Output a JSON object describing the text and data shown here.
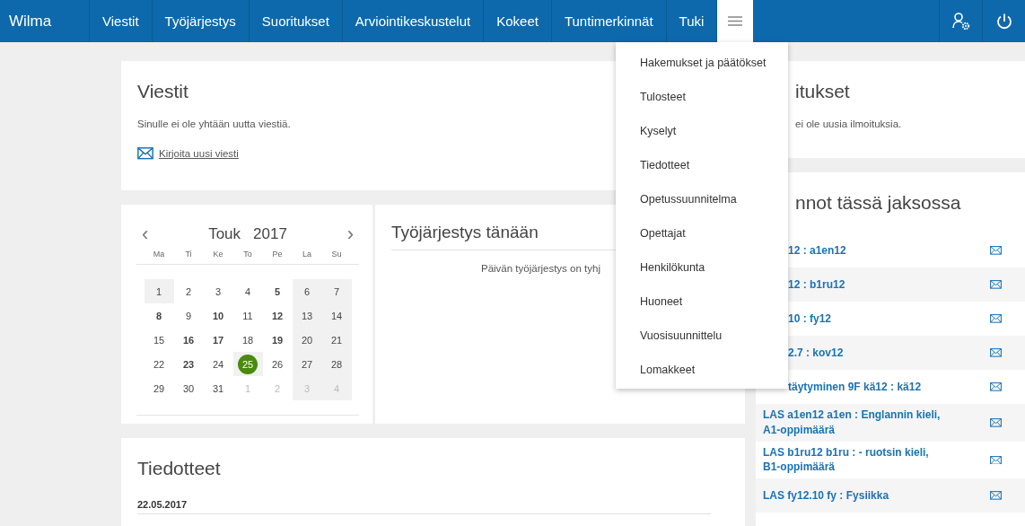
{
  "nav": {
    "brand": "Wilma",
    "items": [
      {
        "label": "Viestit",
        "selected": false
      },
      {
        "label": "Työjärjestys",
        "selected": false
      },
      {
        "label": "Suoritukset",
        "selected": false
      },
      {
        "label": "Arviointikeskustelut",
        "selected": false
      },
      {
        "label": "Kokeet",
        "selected": false
      },
      {
        "label": "Tuntimerkinnät",
        "selected": false
      },
      {
        "label": "Tuki",
        "selected": false
      }
    ],
    "menu_button": {
      "expanded": true
    }
  },
  "menu": {
    "items": [
      "Hakemukset ja päätökset",
      "Tulosteet",
      "Kyselyt",
      "Tiedotteet",
      "Opetussuunnitelma",
      "Opettajat",
      "Henkilökunta",
      "Huoneet",
      "Vuosisuunnittelu",
      "Lomakkeet"
    ]
  },
  "messages": {
    "title": "Viestit",
    "text": "Sinulle ei ole yhtään uutta viestiä.",
    "link": "Kirjoita uusi viesti"
  },
  "calendar": {
    "prev": "‹",
    "month": "Touk",
    "year": "2017",
    "next": "›",
    "weekdays": [
      "Ma",
      "Ti",
      "Ke",
      "To",
      "Pe",
      "La",
      "Su"
    ],
    "days": [
      {
        "d": "1",
        "bold": false,
        "muted": false,
        "shaded": true,
        "today": false
      },
      {
        "d": "2",
        "bold": false,
        "muted": false,
        "shaded": false,
        "today": false
      },
      {
        "d": "3",
        "bold": false,
        "muted": false,
        "shaded": false,
        "today": false
      },
      {
        "d": "4",
        "bold": false,
        "muted": false,
        "shaded": false,
        "today": false
      },
      {
        "d": "5",
        "bold": true,
        "muted": false,
        "shaded": false,
        "today": false
      },
      {
        "d": "6",
        "bold": false,
        "muted": false,
        "shaded": true,
        "today": false
      },
      {
        "d": "7",
        "bold": false,
        "muted": false,
        "shaded": true,
        "today": false
      },
      {
        "d": "8",
        "bold": true,
        "muted": false,
        "shaded": false,
        "today": false
      },
      {
        "d": "9",
        "bold": false,
        "muted": false,
        "shaded": false,
        "today": false
      },
      {
        "d": "10",
        "bold": true,
        "muted": false,
        "shaded": false,
        "today": false
      },
      {
        "d": "11",
        "bold": false,
        "muted": false,
        "shaded": false,
        "today": false
      },
      {
        "d": "12",
        "bold": true,
        "muted": false,
        "shaded": false,
        "today": false
      },
      {
        "d": "13",
        "bold": false,
        "muted": false,
        "shaded": true,
        "today": false
      },
      {
        "d": "14",
        "bold": false,
        "muted": false,
        "shaded": true,
        "today": false
      },
      {
        "d": "15",
        "bold": false,
        "muted": false,
        "shaded": false,
        "today": false
      },
      {
        "d": "16",
        "bold": true,
        "muted": false,
        "shaded": false,
        "today": false
      },
      {
        "d": "17",
        "bold": true,
        "muted": false,
        "shaded": false,
        "today": false
      },
      {
        "d": "18",
        "bold": false,
        "muted": false,
        "shaded": false,
        "today": false
      },
      {
        "d": "19",
        "bold": true,
        "muted": false,
        "shaded": false,
        "today": false
      },
      {
        "d": "20",
        "bold": false,
        "muted": false,
        "shaded": true,
        "today": false
      },
      {
        "d": "21",
        "bold": false,
        "muted": false,
        "shaded": true,
        "today": false
      },
      {
        "d": "22",
        "bold": false,
        "muted": false,
        "shaded": false,
        "today": false
      },
      {
        "d": "23",
        "bold": true,
        "muted": false,
        "shaded": false,
        "today": false
      },
      {
        "d": "24",
        "bold": false,
        "muted": false,
        "shaded": false,
        "today": false
      },
      {
        "d": "25",
        "bold": false,
        "muted": false,
        "shaded": true,
        "today": true
      },
      {
        "d": "26",
        "bold": false,
        "muted": false,
        "shaded": false,
        "today": false
      },
      {
        "d": "27",
        "bold": false,
        "muted": false,
        "shaded": true,
        "today": false
      },
      {
        "d": "28",
        "bold": false,
        "muted": false,
        "shaded": true,
        "today": false
      },
      {
        "d": "29",
        "bold": false,
        "muted": false,
        "shaded": false,
        "today": false
      },
      {
        "d": "30",
        "bold": false,
        "muted": false,
        "shaded": false,
        "today": false
      },
      {
        "d": "31",
        "bold": false,
        "muted": false,
        "shaded": false,
        "today": false
      },
      {
        "d": "1",
        "bold": false,
        "muted": true,
        "shaded": false,
        "today": false
      },
      {
        "d": "2",
        "bold": false,
        "muted": true,
        "shaded": false,
        "today": false
      },
      {
        "d": "3",
        "bold": false,
        "muted": true,
        "shaded": true,
        "today": false
      },
      {
        "d": "4",
        "bold": false,
        "muted": true,
        "shaded": true,
        "today": false
      }
    ]
  },
  "schedule": {
    "title": "Työjärjestys tänään",
    "text": "Päivän työjärjestys on tyhj"
  },
  "notices": {
    "title": "Tiedotteet",
    "date": "22.05.2017"
  },
  "announcements": {
    "title": "itukset",
    "text": "ei ole uusia ilmoituksia."
  },
  "courses": {
    "title": "nnot tässä jaksossa",
    "rows": [
      {
        "label": "12 : a1en12",
        "hidden_start": true
      },
      {
        "label": "12 : b1ru12",
        "hidden_start": true
      },
      {
        "label": "10 : fy12",
        "hidden_start": true
      },
      {
        "label": "2.7 : kov12",
        "hidden_start": true
      },
      {
        "label": "täytyminen 9F kä12 : kä12",
        "hidden_start": true
      },
      {
        "label": "LAS a1en12 a1en : Englannin kieli, A1-oppimäärä",
        "hidden_start": false
      },
      {
        "label": "LAS b1ru12 b1ru : - ruotsin kieli, B1-oppimäärä",
        "hidden_start": false
      },
      {
        "label": "LAS fy12.10 fy : Fysiikka",
        "hidden_start": false
      }
    ]
  }
}
